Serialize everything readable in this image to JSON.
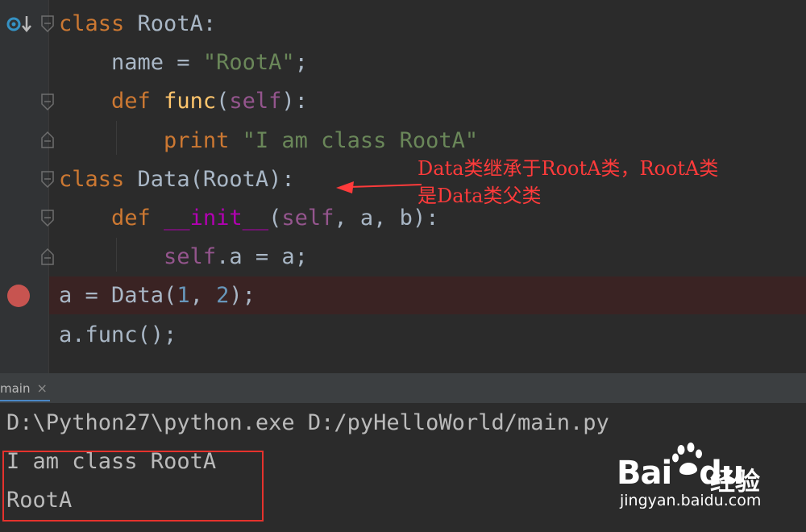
{
  "editor": {
    "lines": [
      {
        "parts": [
          {
            "t": "class ",
            "c": "kw"
          },
          {
            "t": "RootA:",
            "c": ""
          }
        ]
      },
      {
        "parts": [
          {
            "t": "    name = ",
            "c": ""
          },
          {
            "t": "\"RootA\"",
            "c": "str"
          },
          {
            "t": ";",
            "c": ""
          }
        ]
      },
      {
        "parts": [
          {
            "t": "    ",
            "c": ""
          },
          {
            "t": "def ",
            "c": "kw"
          },
          {
            "t": "func",
            "c": "fn"
          },
          {
            "t": "(",
            "c": ""
          },
          {
            "t": "self",
            "c": "slf"
          },
          {
            "t": "):",
            "c": ""
          }
        ]
      },
      {
        "parts": [
          {
            "t": "        ",
            "c": ""
          },
          {
            "t": "print ",
            "c": "kw"
          },
          {
            "t": "\"I am class RootA\"",
            "c": "str"
          }
        ]
      },
      {
        "parts": [
          {
            "t": "class ",
            "c": "kw"
          },
          {
            "t": "Data(RootA):",
            "c": ""
          }
        ]
      },
      {
        "parts": [
          {
            "t": "    ",
            "c": ""
          },
          {
            "t": "def ",
            "c": "kw"
          },
          {
            "t": "__init__",
            "c": "magic"
          },
          {
            "t": "(",
            "c": ""
          },
          {
            "t": "self",
            "c": "slf"
          },
          {
            "t": ", a, b):",
            "c": ""
          }
        ]
      },
      {
        "parts": [
          {
            "t": "        ",
            "c": ""
          },
          {
            "t": "self",
            "c": "slf"
          },
          {
            "t": ".a = a;",
            "c": ""
          }
        ]
      },
      {
        "parts": [
          {
            "t": "a = Data(",
            "c": ""
          },
          {
            "t": "1",
            "c": "num"
          },
          {
            "t": ", ",
            "c": ""
          },
          {
            "t": "2",
            "c": "num"
          },
          {
            "t": ");",
            "c": ""
          }
        ]
      },
      {
        "parts": [
          {
            "t": "a.func();",
            "c": ""
          }
        ]
      }
    ],
    "breakpoint_line": 8,
    "annotation": "Data类继承于RootA类，RootA类\n是Data类父类",
    "colors": {
      "keyword": "#cc7832",
      "string": "#6a8759",
      "function": "#ffc66d",
      "self": "#94558d",
      "number": "#6897bb",
      "magic": "#b200b2",
      "annotation": "#ff3b3b",
      "breakpoint": "#c75450"
    }
  },
  "run_tab": {
    "label": "main",
    "close_icon": "close-icon"
  },
  "console": {
    "lines": [
      "D:\\Python27\\python.exe D:/pyHelloWorld/main.py",
      "I am class RootA",
      "RootA"
    ]
  },
  "watermark": {
    "brand_latin": "Bai",
    "brand_du": "du",
    "brand_cn": "经验",
    "url": "jingyan.baidu.com"
  }
}
